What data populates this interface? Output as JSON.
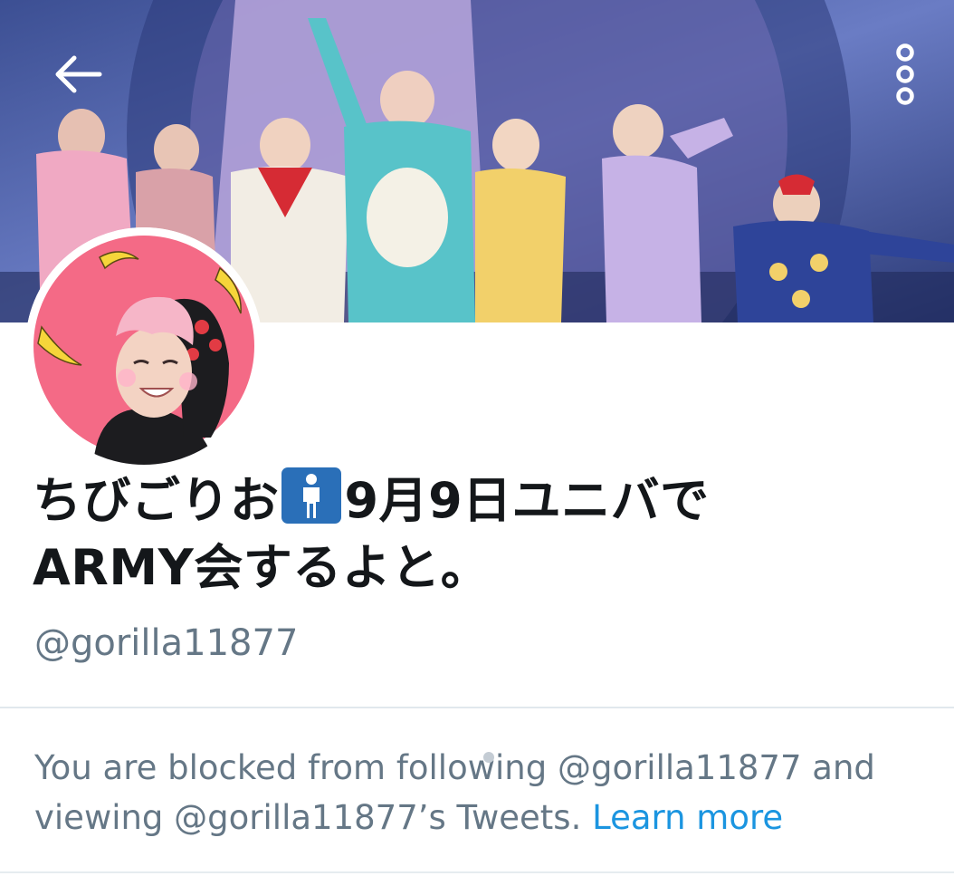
{
  "header": {
    "back_icon": "arrow-left-icon",
    "more_icon": "vertical-dots-icon",
    "banner_description_colors": {
      "sky": "#4a5fa8",
      "stage": "#7c8fcf"
    }
  },
  "profile": {
    "name_part1": "ちびごりお",
    "name_emoji": "standing-person-emoji",
    "name_part2": "9月9日ユニバで",
    "name_line2": "ARMY会するよと。",
    "handle": "@gorilla11877",
    "avatar_icon": "profile-avatar"
  },
  "notice": {
    "text": "You are blocked from following @gorilla11877 and viewing @gorilla11877’s Tweets.",
    "link": "Learn more"
  },
  "colors": {
    "name_text": "#14171a",
    "secondary_text": "#657786",
    "link": "#1b95e0",
    "divider": "#e1e8ed"
  }
}
